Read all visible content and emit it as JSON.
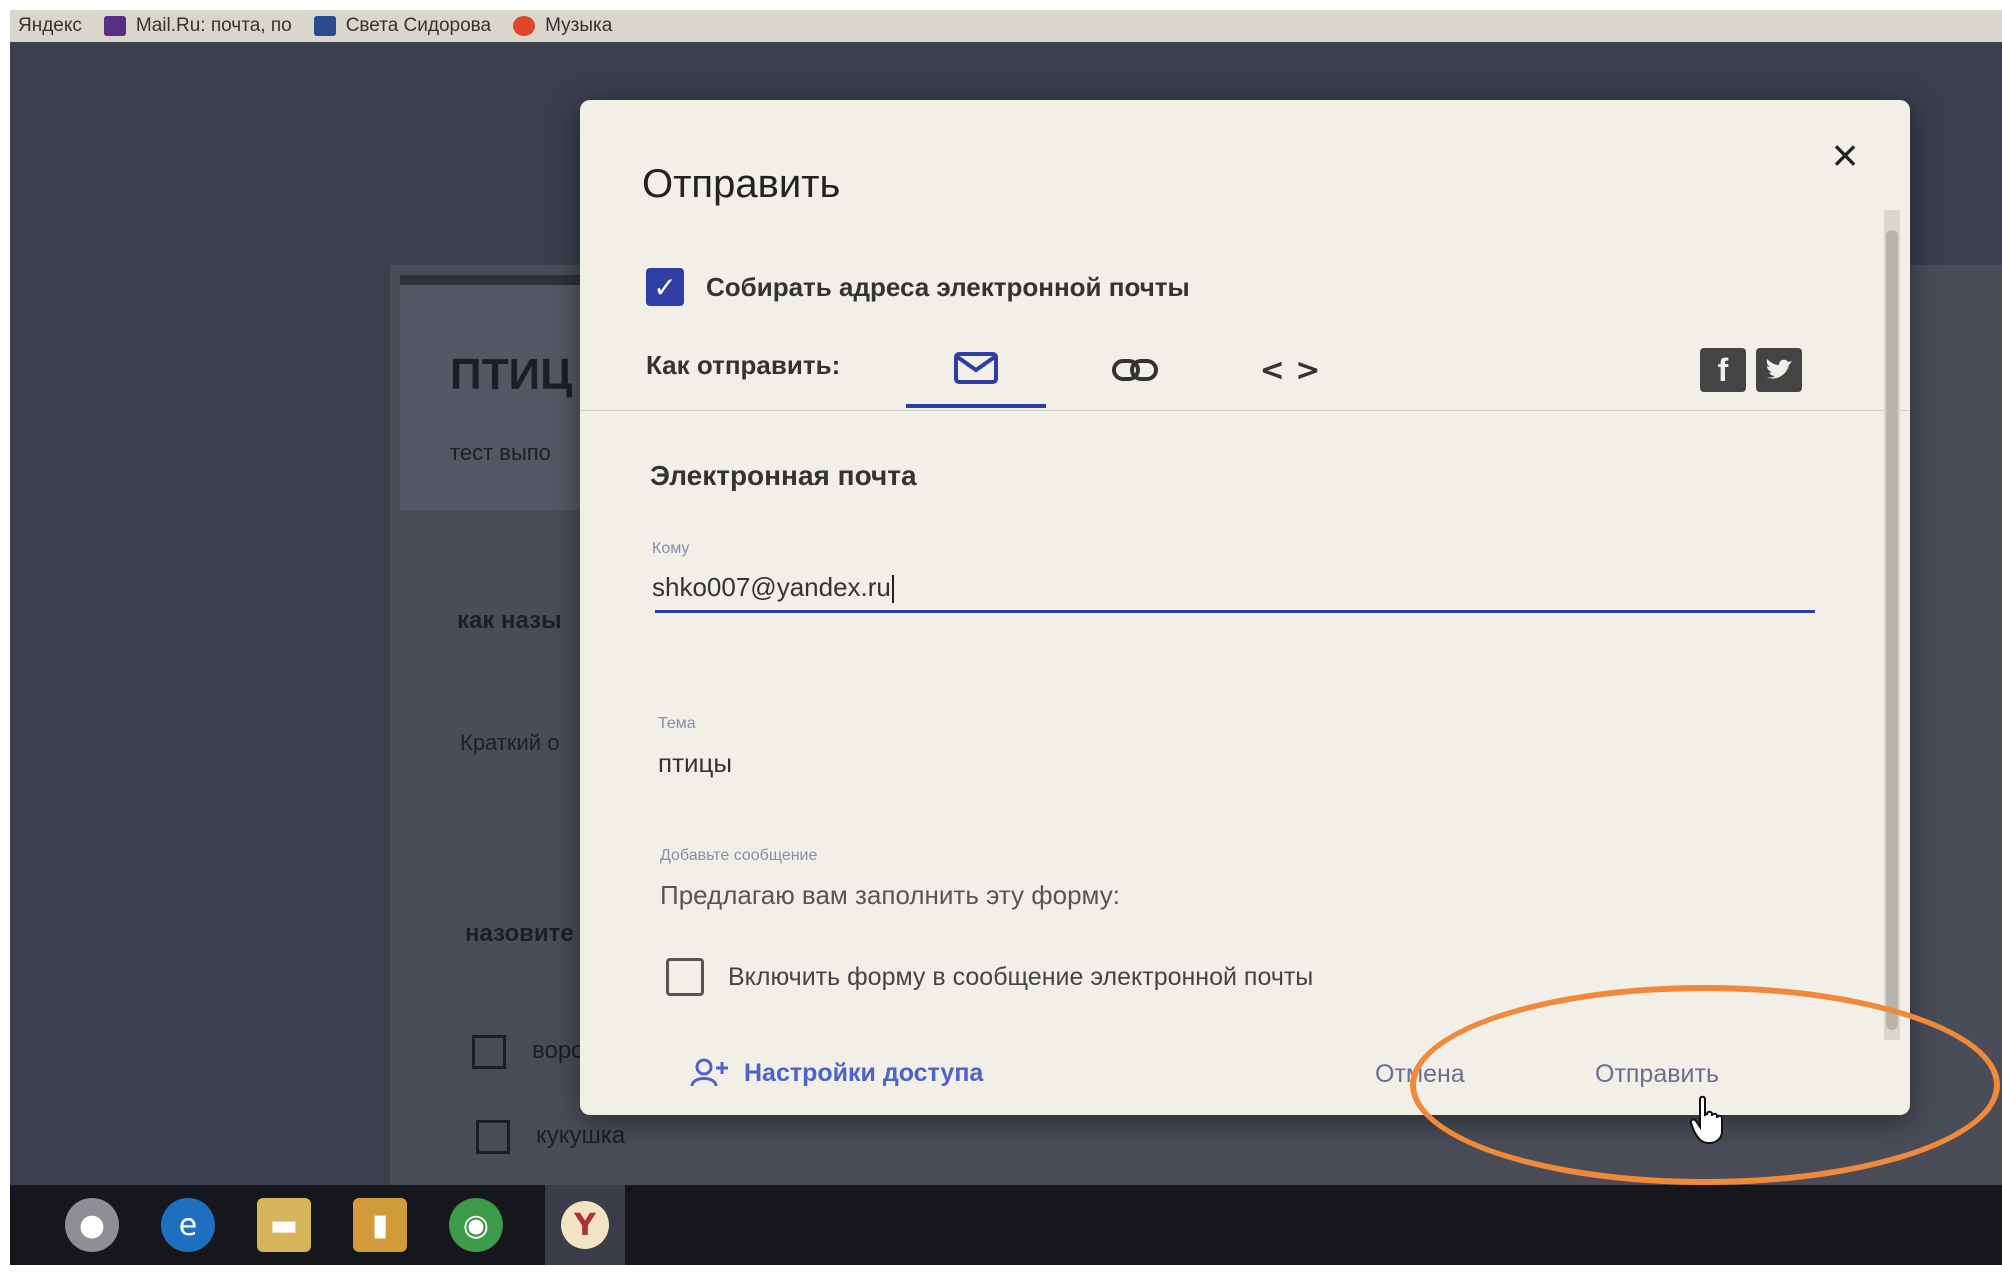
{
  "browser": {
    "bookmarks": [
      {
        "label": "Яндекс",
        "color": "#d9d6cc"
      },
      {
        "label": "Mail.Ru: почта, по",
        "color": "#5a2d82"
      },
      {
        "label": "Света Сидорова",
        "color": "#2a4b8d"
      },
      {
        "label": "Музыка",
        "color": "#e0452b"
      }
    ]
  },
  "background_form": {
    "title": "ПТИЦ",
    "description": "тест выпо",
    "question1": "как назы",
    "short_answer": "Краткий о",
    "question2": "назовите",
    "option1": "воро",
    "option2": "кукушка"
  },
  "dialog": {
    "title": "Отправить",
    "close_icon": "×",
    "collect_emails_label": "Собирать адреса электронной почты",
    "collect_emails_checked": true,
    "send_via_label": "Как отправить:",
    "tabs": [
      {
        "name": "email",
        "icon": "envelope-icon"
      },
      {
        "name": "link",
        "icon": "link-icon"
      },
      {
        "name": "embed",
        "icon": "code-icon",
        "glyph": "< >"
      }
    ],
    "social": {
      "facebook": "f",
      "twitter": "twitter-icon"
    },
    "section_title": "Электронная почта",
    "to_label": "Кому",
    "to_value": "shko007@yandex.ru",
    "subject_label": "Тема",
    "subject_value": "птицы",
    "message_label": "Добавьте сообщение",
    "message_value": "Предлагаю вам заполнить эту форму:",
    "include_form_label": "Включить форму в сообщение электронной почты",
    "include_form_checked": false,
    "access_settings_label": "Настройки доступа",
    "cancel_label": "Отмена",
    "send_label": "Отправить"
  },
  "taskbar": {
    "apps": [
      "start-icon",
      "edge-icon",
      "file-explorer-icon",
      "notes-icon",
      "chrome-icon",
      "yandex-browser-icon"
    ]
  },
  "colors": {
    "accent": "#2e3ea3",
    "annotation": "#f08a3a"
  }
}
